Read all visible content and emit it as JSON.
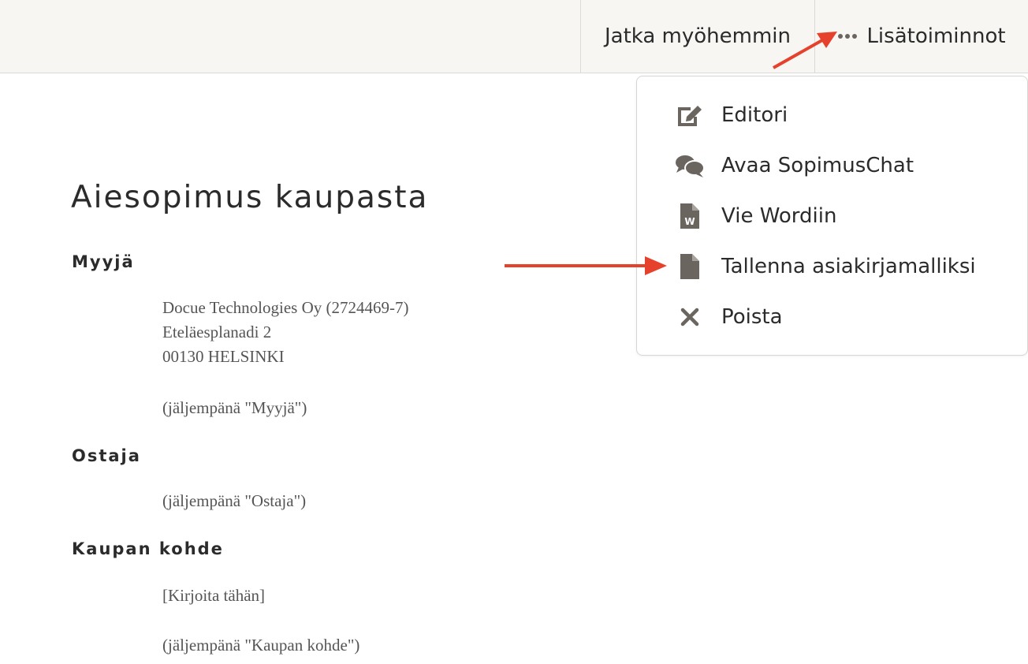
{
  "header": {
    "continue_later_label": "Jatka myöhemmin",
    "more_actions_label": "Lisätoiminnot"
  },
  "more_menu": {
    "items": [
      {
        "label": "Editori",
        "icon": "edit-icon"
      },
      {
        "label": "Avaa SopimusChat",
        "icon": "chat-icon"
      },
      {
        "label": "Vie Wordiin",
        "icon": "word-file-icon"
      },
      {
        "label": "Tallenna asiakirjamalliksi",
        "icon": "file-icon"
      },
      {
        "label": "Poista",
        "icon": "close-icon"
      }
    ]
  },
  "document": {
    "title": "Aiesopimus kaupasta",
    "seller": {
      "heading": "Myyjä",
      "company": "Docue Technologies Oy (2724469-7)",
      "street": "Eteläesplanadi 2",
      "city": "00130 HELSINKI",
      "alias": "(jäljempänä \"Myyjä\")"
    },
    "buyer": {
      "heading": "Ostaja",
      "alias": "(jäljempänä \"Ostaja\")"
    },
    "subject": {
      "heading": "Kaupan kohde",
      "placeholder": "[Kirjoita tähän]",
      "alias": "(jäljempänä \"Kaupan kohde\")"
    }
  },
  "colors": {
    "topbar_bg": "#f7f6f3",
    "icon_gray": "#6b6560",
    "annotation_arrow": "#e5412d"
  }
}
